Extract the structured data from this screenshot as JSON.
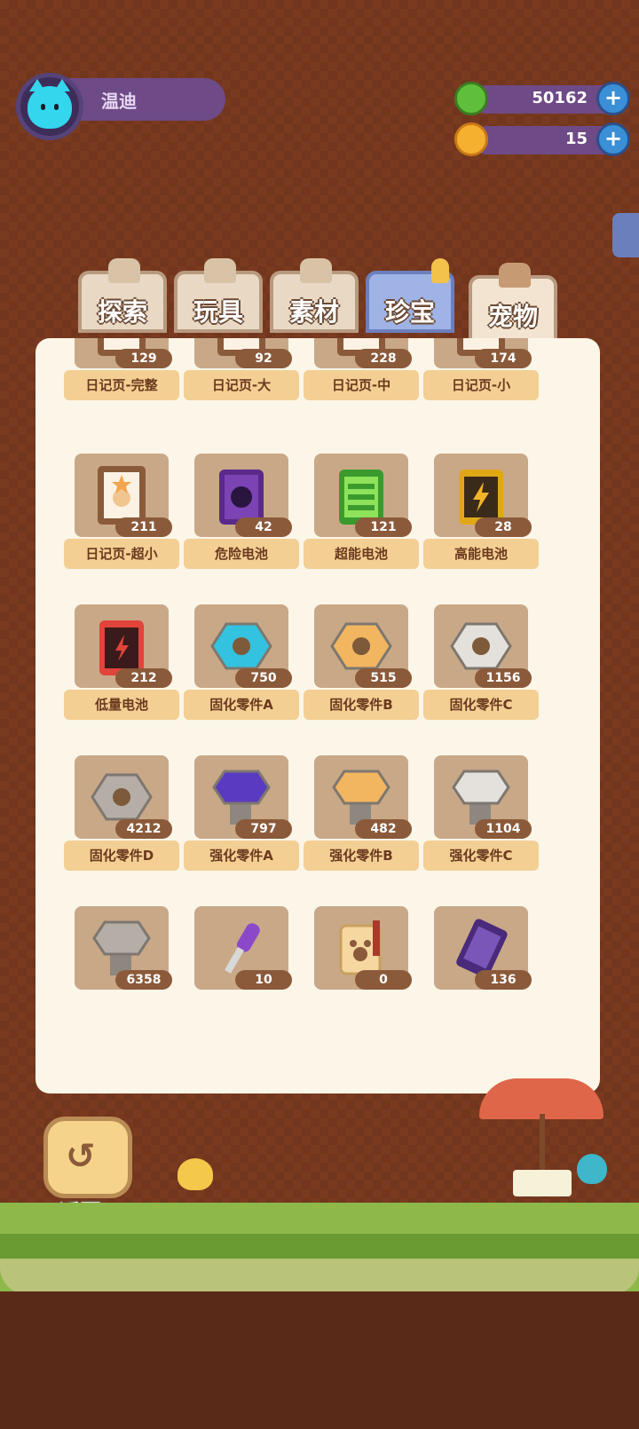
{
  "player": {
    "name": "温迪"
  },
  "currency": {
    "primary": {
      "value": "50162",
      "plus": "+"
    },
    "secondary": {
      "value": "15",
      "plus": "+"
    }
  },
  "tabs": [
    {
      "label": "探索"
    },
    {
      "label": "玩具"
    },
    {
      "label": "素材"
    },
    {
      "label": "珍宝"
    },
    {
      "label": "宠物"
    }
  ],
  "items": [
    {
      "name": "日记页-完整",
      "count": "129",
      "icon": "diary-page-icon"
    },
    {
      "name": "日记页-大",
      "count": "92",
      "icon": "diary-page-icon"
    },
    {
      "name": "日记页-中",
      "count": "228",
      "icon": "diary-page-icon"
    },
    {
      "name": "日记页-小",
      "count": "174",
      "icon": "diary-page-icon"
    },
    {
      "name": "日记页-超小",
      "count": "211",
      "icon": "diary-page-icon"
    },
    {
      "name": "危险电池",
      "count": "42",
      "icon": "danger-battery-icon"
    },
    {
      "name": "超能电池",
      "count": "121",
      "icon": "super-battery-icon"
    },
    {
      "name": "高能电池",
      "count": "28",
      "icon": "high-battery-icon"
    },
    {
      "name": "低量电池",
      "count": "212",
      "icon": "low-battery-icon"
    },
    {
      "name": "固化零件A",
      "count": "750",
      "icon": "nut-icon"
    },
    {
      "name": "固化零件B",
      "count": "515",
      "icon": "nut-icon"
    },
    {
      "name": "固化零件C",
      "count": "1156",
      "icon": "nut-icon"
    },
    {
      "name": "固化零件D",
      "count": "4212",
      "icon": "nut-icon"
    },
    {
      "name": "强化零件A",
      "count": "797",
      "icon": "bolt-icon"
    },
    {
      "name": "强化零件B",
      "count": "482",
      "icon": "bolt-icon"
    },
    {
      "name": "强化零件C",
      "count": "1104",
      "icon": "bolt-icon"
    },
    {
      "name": "",
      "count": "6358",
      "icon": "bolt-icon"
    },
    {
      "name": "",
      "count": "10",
      "icon": "screwdriver-icon"
    },
    {
      "name": "",
      "count": "0",
      "icon": "paw-tag-icon"
    },
    {
      "name": "",
      "count": "136",
      "icon": "ticket-icon"
    }
  ],
  "back_button": {
    "label": "返回"
  },
  "colors": {
    "background": "#7a3a1f",
    "panel": "#fcf6e9",
    "label_bg": "#f3cf93",
    "count_bg": "#8b5a3a",
    "purple_bar": "#6e4a86"
  }
}
